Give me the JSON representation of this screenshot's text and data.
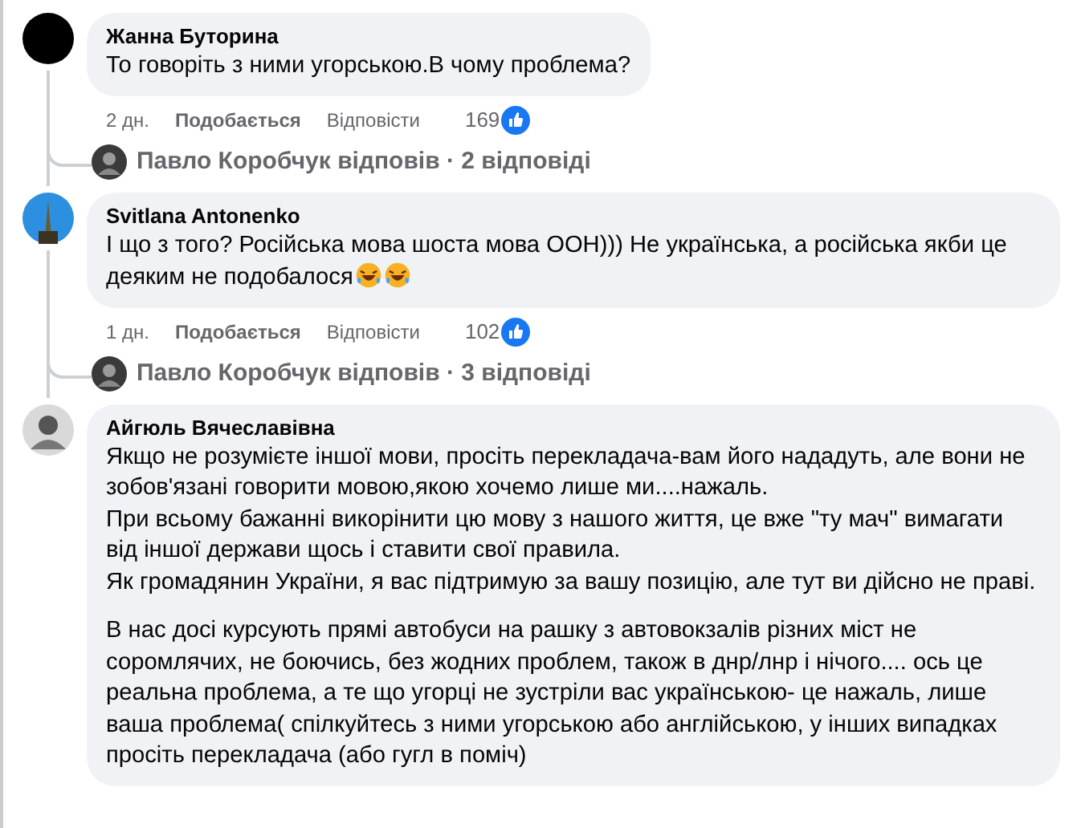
{
  "comments": [
    {
      "author": "Жанна Буторина",
      "paragraphs": [
        [
          "То говоріть з ними угорською.В чому проблема?"
        ]
      ],
      "laughing_emoji": false,
      "time": "2 дн.",
      "like": "Подобається",
      "reply": "Відповісти",
      "reactions": "169",
      "replies": {
        "text": "Павло Коробчук відповів · 2 відповіді"
      }
    },
    {
      "author": "Svitlana Antonenko",
      "paragraphs": [
        [
          "І що з того? Російська мова шоста мова ООН))) Не українська, а російська якби це деяким не подобалося"
        ]
      ],
      "laughing_emoji": true,
      "time": "1 дн.",
      "like": "Подобається",
      "reply": "Відповісти",
      "reactions": "102",
      "replies": {
        "text": "Павло Коробчук відповів · 3 відповіді"
      }
    },
    {
      "author": "Айгюль Вячеславівна",
      "paragraphs": [
        [
          "Якщо не розумієте іншої мови, просіть перекладача-вам його нададуть, але вони не зобов'язані говорити мовою,якою хочемо лише ми....нажаль.",
          "При всьому бажанні викорінити цю мову з нашого життя, це вже \"ту мач\" вимагати від іншої держави щось і ставити свої правила.",
          "Як громадянин України, я вас підтримую за вашу позицію, але тут ви дійсно не праві."
        ],
        [
          "В нас досі курсують прямі автобуси на рашку з автовокзалів різних міст не соромлячих, не боючись, без жодних проблем, також в днр/лнр і нічого.... ось це реальна проблема, а те що угорці не зустріли вас українською- це нажаль, лише ваша проблема( спілкуйтесь з ними угорською або англійською, у інших випадках просіть перекладача (або гугл в поміч)"
        ]
      ],
      "laughing_emoji": false
    }
  ]
}
